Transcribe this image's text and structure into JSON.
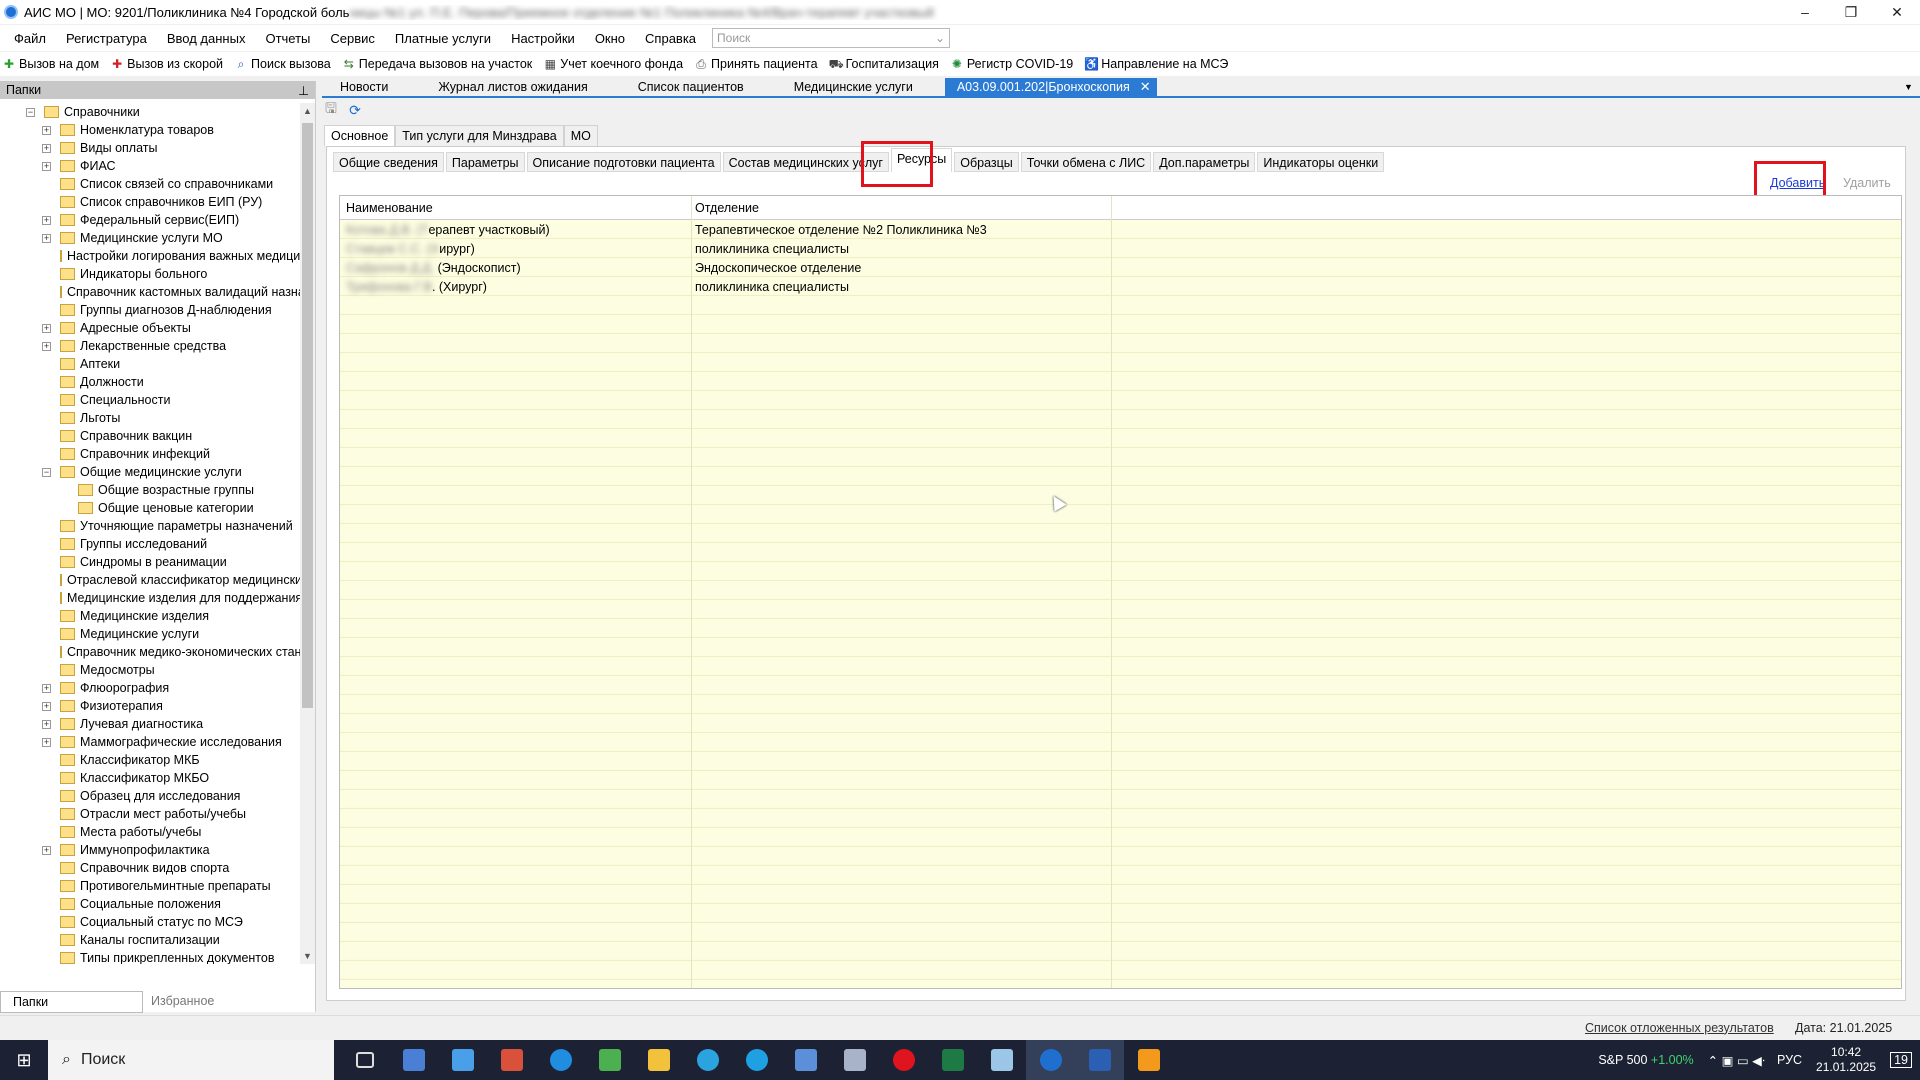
{
  "window": {
    "title": "АИС МО | МО: 9201/Поликлиника №4 Городской боль",
    "title_blurred": "ницы №1 ул. П.Е. Перова/Приемное отделение №1 Поликлиника №4/Врач-терапевт участковый",
    "minimize": "–",
    "maximize": "❐",
    "close": "✕"
  },
  "menu": {
    "items": [
      "Файл",
      "Регистратура",
      "Ввод данных",
      "Отчеты",
      "Сервис",
      "Платные услуги",
      "Настройки",
      "Окно",
      "Справка"
    ],
    "search_placeholder": "Поиск"
  },
  "toolbar": {
    "items": [
      {
        "label": "Вызов на дом",
        "icon": "home-call-icon",
        "color": "#27a02f",
        "glyph": "✚"
      },
      {
        "label": "Вызов из скорой",
        "icon": "ambulance-icon",
        "color": "#d3202a",
        "glyph": "✚"
      },
      {
        "label": "Поиск вызова",
        "icon": "search-call-icon",
        "color": "#1e5bb8",
        "glyph": "⌕"
      },
      {
        "label": "Передача вызовов на участок",
        "icon": "transfer-icon",
        "color": "#3a7a2e",
        "glyph": "⇆"
      },
      {
        "label": "Учет коечного фонда",
        "icon": "bed-fund-icon",
        "color": "#444444",
        "glyph": "▦"
      },
      {
        "label": "Принять пациента",
        "icon": "accept-patient-icon",
        "color": "#555555",
        "glyph": "⎙"
      },
      {
        "label": "Госпитализация",
        "icon": "hospitalization-icon",
        "color": "#444444",
        "glyph": "⛟"
      },
      {
        "label": "Регистр COVID-19",
        "icon": "covid-icon",
        "color": "#1d8c3a",
        "glyph": "✺"
      },
      {
        "label": "Направление на МСЭ",
        "icon": "mse-icon",
        "color": "#333333",
        "glyph": "♿"
      }
    ]
  },
  "left_panel": {
    "header": "Папки",
    "pin": "⊥",
    "tree": [
      {
        "label": "Справочники",
        "level": 0,
        "exp": "−"
      },
      {
        "label": "Номенклатура товаров",
        "level": 1,
        "exp": "+"
      },
      {
        "label": "Виды оплаты",
        "level": 1,
        "exp": "+"
      },
      {
        "label": "ФИАС",
        "level": 1,
        "exp": "+"
      },
      {
        "label": "Список связей со справочниками",
        "level": 1,
        "exp": ""
      },
      {
        "label": "Список справочников ЕИП (РУ)",
        "level": 1,
        "exp": ""
      },
      {
        "label": "Федеральный сервис(ЕИП)",
        "level": 1,
        "exp": "+"
      },
      {
        "label": "Медицинские услуги МО",
        "level": 1,
        "exp": "+"
      },
      {
        "label": "Настройки логирования важных медицинс",
        "level": 1,
        "exp": ""
      },
      {
        "label": "Индикаторы больного",
        "level": 1,
        "exp": ""
      },
      {
        "label": "Справочник кастомных валидаций назнач",
        "level": 1,
        "exp": ""
      },
      {
        "label": "Группы диагнозов Д-наблюдения",
        "level": 1,
        "exp": ""
      },
      {
        "label": "Адресные объекты",
        "level": 1,
        "exp": "+"
      },
      {
        "label": "Лекарственные средства",
        "level": 1,
        "exp": "+"
      },
      {
        "label": "Аптеки",
        "level": 1,
        "exp": ""
      },
      {
        "label": "Должности",
        "level": 1,
        "exp": ""
      },
      {
        "label": "Специальности",
        "level": 1,
        "exp": ""
      },
      {
        "label": "Льготы",
        "level": 1,
        "exp": ""
      },
      {
        "label": "Справочник вакцин",
        "level": 1,
        "exp": ""
      },
      {
        "label": "Справочник инфекций",
        "level": 1,
        "exp": ""
      },
      {
        "label": "Общие медицинские услуги",
        "level": 1,
        "exp": "−"
      },
      {
        "label": "Общие возрастные группы",
        "level": 2,
        "exp": ""
      },
      {
        "label": "Общие ценовые категории",
        "level": 2,
        "exp": ""
      },
      {
        "label": "Уточняющие параметры назначений",
        "level": 1,
        "exp": ""
      },
      {
        "label": "Группы исследований",
        "level": 1,
        "exp": ""
      },
      {
        "label": "Синдромы в реанимации",
        "level": 1,
        "exp": ""
      },
      {
        "label": "Отраслевой классификатор медицинских у",
        "level": 1,
        "exp": ""
      },
      {
        "label": "Медицинские изделия для поддержания ор",
        "level": 1,
        "exp": ""
      },
      {
        "label": "Медицинские изделия",
        "level": 1,
        "exp": ""
      },
      {
        "label": "Медицинские услуги",
        "level": 1,
        "exp": ""
      },
      {
        "label": "Справочник медико-экономических станд",
        "level": 1,
        "exp": ""
      },
      {
        "label": "Медосмотры",
        "level": 1,
        "exp": ""
      },
      {
        "label": "Флюорография",
        "level": 1,
        "exp": "+"
      },
      {
        "label": "Физиотерапия",
        "level": 1,
        "exp": "+"
      },
      {
        "label": "Лучевая диагностика",
        "level": 1,
        "exp": "+"
      },
      {
        "label": "Маммографические исследования",
        "level": 1,
        "exp": "+"
      },
      {
        "label": "Классификатор МКБ",
        "level": 1,
        "exp": ""
      },
      {
        "label": "Классификатор МКБО",
        "level": 1,
        "exp": ""
      },
      {
        "label": "Образец для исследования",
        "level": 1,
        "exp": ""
      },
      {
        "label": "Отрасли мест работы/учебы",
        "level": 1,
        "exp": ""
      },
      {
        "label": "Места работы/учебы",
        "level": 1,
        "exp": ""
      },
      {
        "label": "Иммунопрофилактика",
        "level": 1,
        "exp": "+"
      },
      {
        "label": "Справочник видов спорта",
        "level": 1,
        "exp": ""
      },
      {
        "label": "Противогельминтные препараты",
        "level": 1,
        "exp": ""
      },
      {
        "label": "Социальные положения",
        "level": 1,
        "exp": ""
      },
      {
        "label": "Социальный статус по МСЭ",
        "level": 1,
        "exp": ""
      },
      {
        "label": "Каналы госпитализации",
        "level": 1,
        "exp": ""
      },
      {
        "label": "Типы прикрепленных документов",
        "level": 1,
        "exp": ""
      }
    ],
    "bottom_tabs": [
      "Папки",
      "Избранное"
    ]
  },
  "doc_tabs": [
    {
      "label": "Новости",
      "active": false
    },
    {
      "label": "Журнал листов ожидания",
      "active": false
    },
    {
      "label": "Список пациентов",
      "active": false
    },
    {
      "label": "Медицинские услуги",
      "active": false
    },
    {
      "label": "А03.09.001.202|Бронхоскопия",
      "active": true
    }
  ],
  "main_tabs": [
    "Основное",
    "Тип услуги для Минздрава",
    "МО"
  ],
  "sub_tabs": [
    "Общие сведения",
    "Параметры",
    "Описание подготовки пациента",
    "Состав медицинских услуг",
    "Ресурсы",
    "Образцы",
    "Точки обмена с ЛИС",
    "Доп.параметры",
    "Индикаторы оценки"
  ],
  "actions": {
    "add": "Добавить",
    "delete": "Удалить"
  },
  "grid": {
    "columns": [
      "Наименование",
      "Отделение"
    ],
    "rows": [
      {
        "name_hidden": "Котова Д.В. (Т",
        "name": "ерапевт участковый)",
        "dept": "Терапевтическое отделение №2 Поликлиника №3"
      },
      {
        "name_hidden": "Ставцев С.С. (Х",
        "name": "ирург)",
        "dept": "поликлиника специалисты"
      },
      {
        "name_hidden": "Сафронов Д.Д.",
        "name": " (Эндоскопист)",
        "dept": "Эндоскопическое отделение"
      },
      {
        "name_hidden": "Трифонова Г.В",
        "name": ". (Хирург)",
        "dept": "поликлиника специалисты"
      }
    ]
  },
  "status": {
    "link": "Список отложенных результатов",
    "date": "Дата: 21.01.2025"
  },
  "taskbar": {
    "search": "Поиск",
    "stock": "S&P 500",
    "stock_change": "+1.00%",
    "lang": "РУС",
    "time": "10:42",
    "date": "21.01.2025",
    "notif": "19"
  }
}
